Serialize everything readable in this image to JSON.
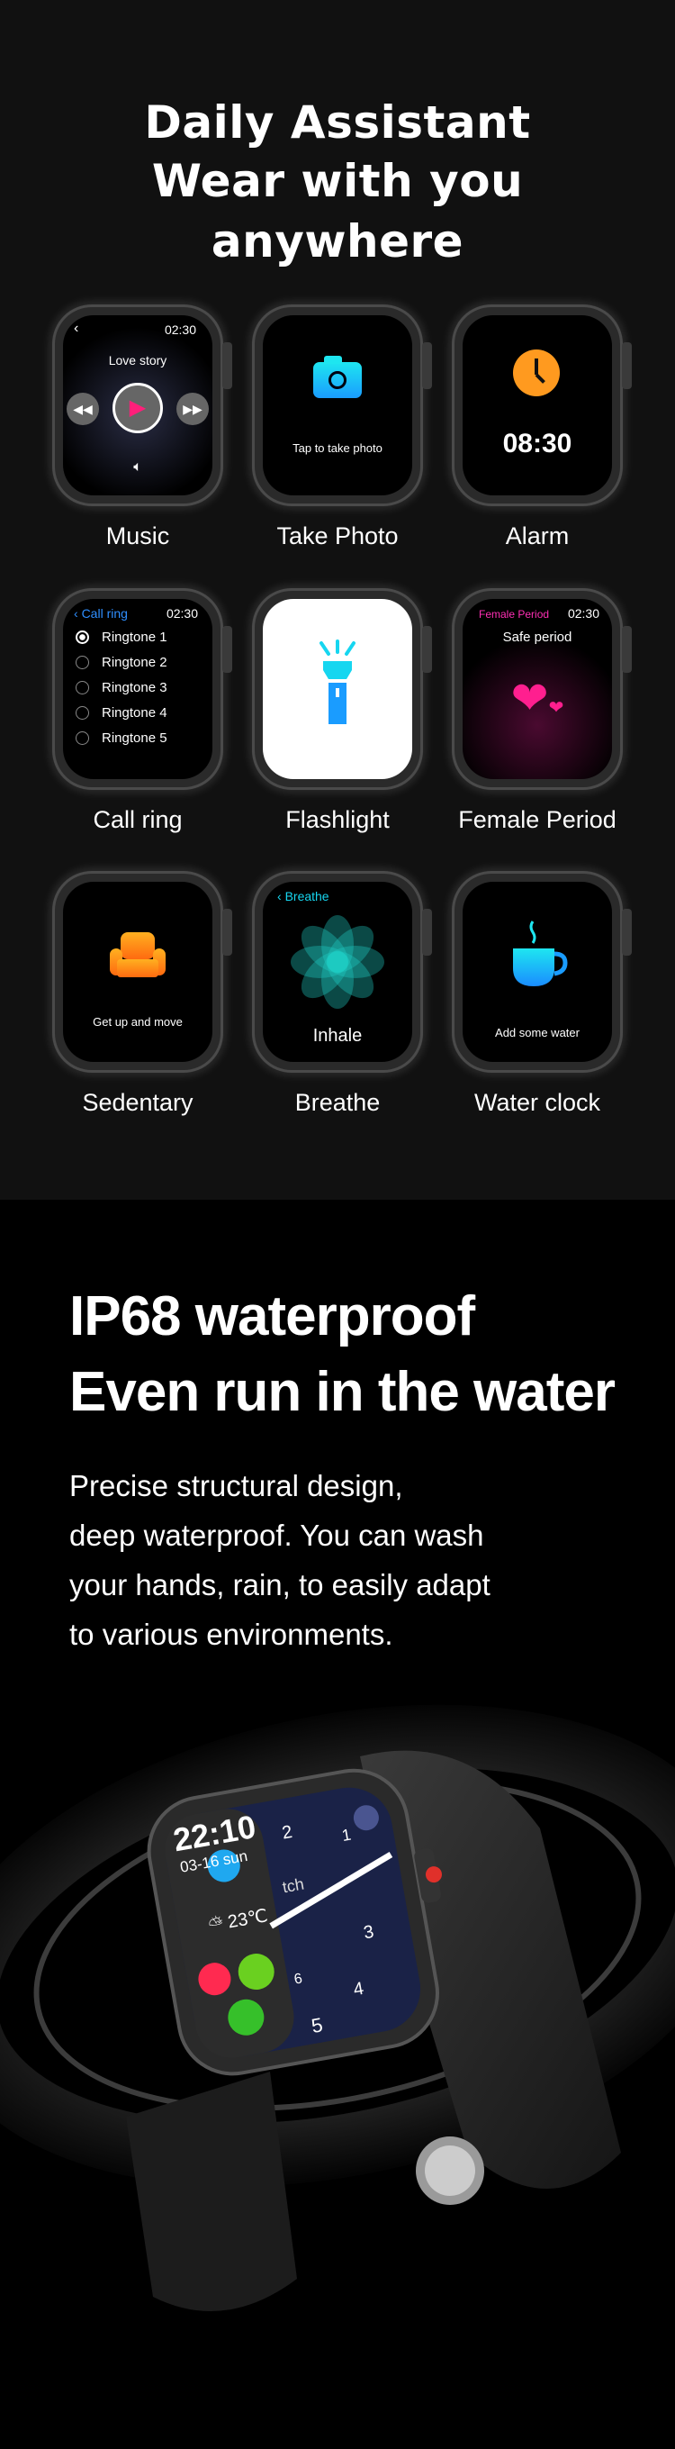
{
  "header": {
    "lines": [
      "Daily Assistant",
      "Wear with you",
      "anywhere"
    ]
  },
  "features": [
    {
      "label": "Music",
      "screen": {
        "time": "02:30",
        "song": "Love story"
      }
    },
    {
      "label": "Take Photo",
      "screen": {
        "text": "Tap to take photo"
      }
    },
    {
      "label": "Alarm",
      "screen": {
        "time": "08:30"
      }
    },
    {
      "label": "Call ring",
      "screen": {
        "title": "Call ring",
        "time": "02:30",
        "items": [
          "Ringtone 1",
          "Ringtone 2",
          "Ringtone 3",
          "Ringtone 4",
          "Ringtone 5"
        ],
        "selected": "Ringtone 1"
      }
    },
    {
      "label": "Flashlight",
      "screen": {}
    },
    {
      "label": "Female Period",
      "screen": {
        "title": "Female Period",
        "time": "02:30",
        "text": "Safe period"
      }
    },
    {
      "label": "Sedentary",
      "screen": {
        "text": "Get up and move"
      }
    },
    {
      "label": "Breathe",
      "screen": {
        "title": "Breathe",
        "text": "Inhale"
      }
    },
    {
      "label": "Water clock",
      "screen": {
        "text": "Add some water"
      }
    }
  ],
  "waterproof": {
    "title_lines": [
      "IP68 waterproof",
      "Even run in the water"
    ],
    "body_lines": [
      "Precise structural design,",
      "deep waterproof. You can wash",
      "your hands, rain, to easily adapt",
      "to various environments."
    ]
  },
  "watch_face": {
    "time": "22:10",
    "date": "03-16",
    "day": "sun",
    "temp": "23℃",
    "dial": [
      "1",
      "2",
      "3",
      "4",
      "5",
      "6"
    ],
    "partial_text": "tch"
  },
  "colors": {
    "accent_pink": "#ff1f7a",
    "accent_cyan": "#16d6f0",
    "accent_orange": "#ff9a1f",
    "blue_link": "#2f8fff",
    "magenta": "#ff2fb5"
  }
}
